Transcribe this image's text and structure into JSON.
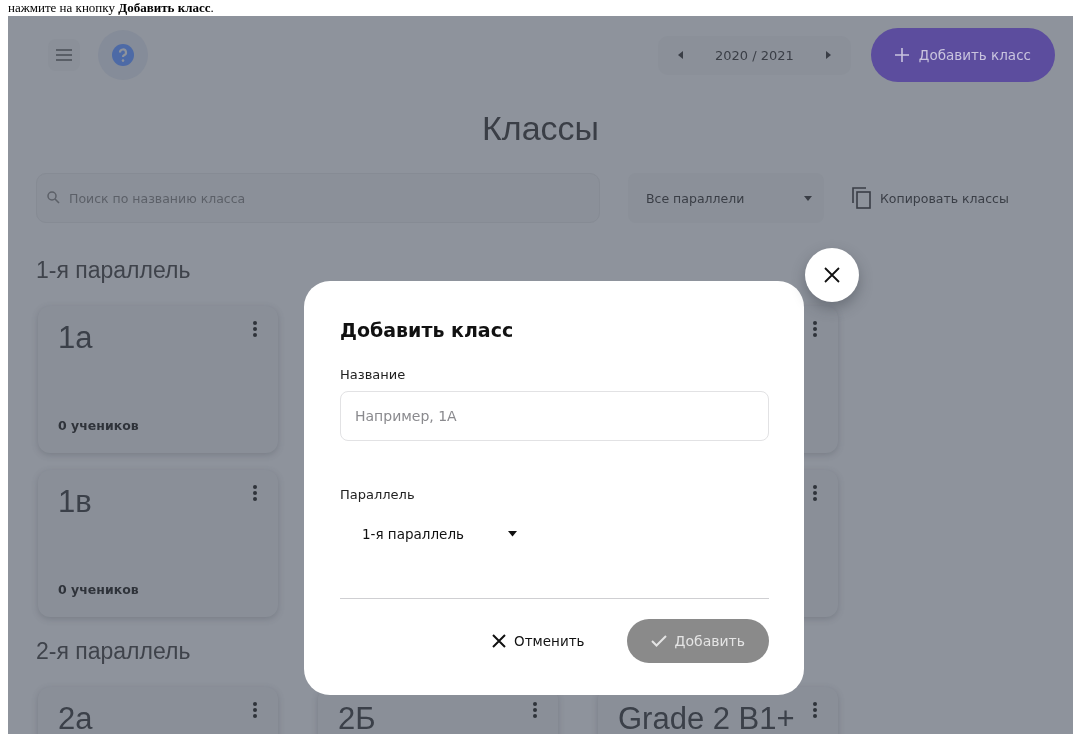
{
  "caption": "нажмите на кнопку **Добавить класс**.",
  "toolbar": {
    "year": "2020 / 2021",
    "add_button": "Добавить класс"
  },
  "title": "Классы",
  "search": {
    "placeholder": "Поиск по названию класса"
  },
  "parallel_filter": {
    "value": "Все параллели"
  },
  "copy_button": "Копировать классы",
  "groups": [
    {
      "title": "1-я параллель",
      "cards": [
        {
          "kind": "card",
          "name": "1а",
          "count": "0 учеников"
        },
        {
          "kind": "covered"
        },
        {
          "kind": "covered"
        },
        {
          "kind": "card",
          "name": "1в",
          "count": "0 учеников"
        },
        {
          "kind": "covered"
        },
        {
          "kind": "covered"
        }
      ]
    },
    {
      "title": "2-я параллель",
      "cards": [
        {
          "kind": "card",
          "name": "2а"
        },
        {
          "kind": "card",
          "name": "2Б"
        },
        {
          "kind": "card",
          "name": "Grade 2 B1+"
        }
      ]
    }
  ],
  "dialog": {
    "title": "Добавить класс",
    "name_label": "Название",
    "name_placeholder": "Например, 1А",
    "parallel_label": "Параллель",
    "parallel_value": "1-я параллель",
    "cancel": "Отменить",
    "submit": {
      "label": "Добавить",
      "disabled": true
    }
  }
}
